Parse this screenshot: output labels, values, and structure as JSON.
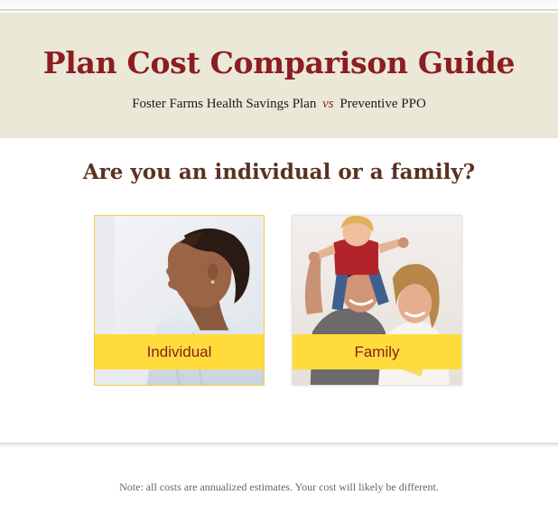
{
  "header": {
    "title": "Plan Cost Comparison Guide",
    "subtitle_plan_a": "Foster Farms Health Savings Plan",
    "subtitle_vs": "vs",
    "subtitle_plan_b": "Preventive PPO"
  },
  "question": "Are you an individual or a family?",
  "options": [
    {
      "label": "Individual",
      "photo": "woman-profile-photo"
    },
    {
      "label": "Family",
      "photo": "family-photo"
    }
  ],
  "footer": {
    "note": "Note: all costs are annualized estimates. Your cost will likely be different."
  },
  "colors": {
    "brand_red": "#8c1d21",
    "question_brown": "#5b3220",
    "header_bg": "#ebe8d8",
    "label_yellow": "#ffdc3c",
    "selected_border": "#f0cf45"
  }
}
